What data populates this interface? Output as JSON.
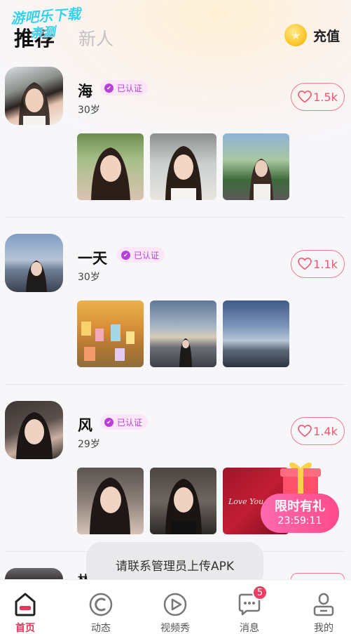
{
  "watermark": {
    "line1": "游吧乐下载",
    "line2": "亲测"
  },
  "header": {
    "tabs": [
      {
        "label": "推荐"
      },
      {
        "label": "新人"
      }
    ],
    "recharge_label": "充值",
    "coin_icon": "coin-icon"
  },
  "verified_label": "已认证",
  "users": [
    {
      "name": "海",
      "age": "30岁",
      "likes": "1.5k"
    },
    {
      "name": "一天",
      "age": "30岁",
      "likes": "1.1k"
    },
    {
      "name": "风",
      "age": "29岁",
      "likes": "1.4k"
    },
    {
      "name": "林",
      "age": "",
      "likes": ""
    }
  ],
  "photo_caption": "Love You",
  "gift": {
    "title": "限时有礼",
    "timer": "23:59:11"
  },
  "toast": "请联系管理员上传APK",
  "tabbar": {
    "items": [
      {
        "label": "首页",
        "icon": "home-icon"
      },
      {
        "label": "动态",
        "icon": "moments-icon"
      },
      {
        "label": "视频秀",
        "icon": "video-icon"
      },
      {
        "label": "消息",
        "icon": "message-icon",
        "badge": "5"
      },
      {
        "label": "我的",
        "icon": "profile-icon"
      }
    ]
  },
  "colors": {
    "accent": "#e8355a",
    "like": "#f2566f",
    "verify": "#b541d9",
    "badge": "#f43b64",
    "watermark": "#36d1f0"
  }
}
